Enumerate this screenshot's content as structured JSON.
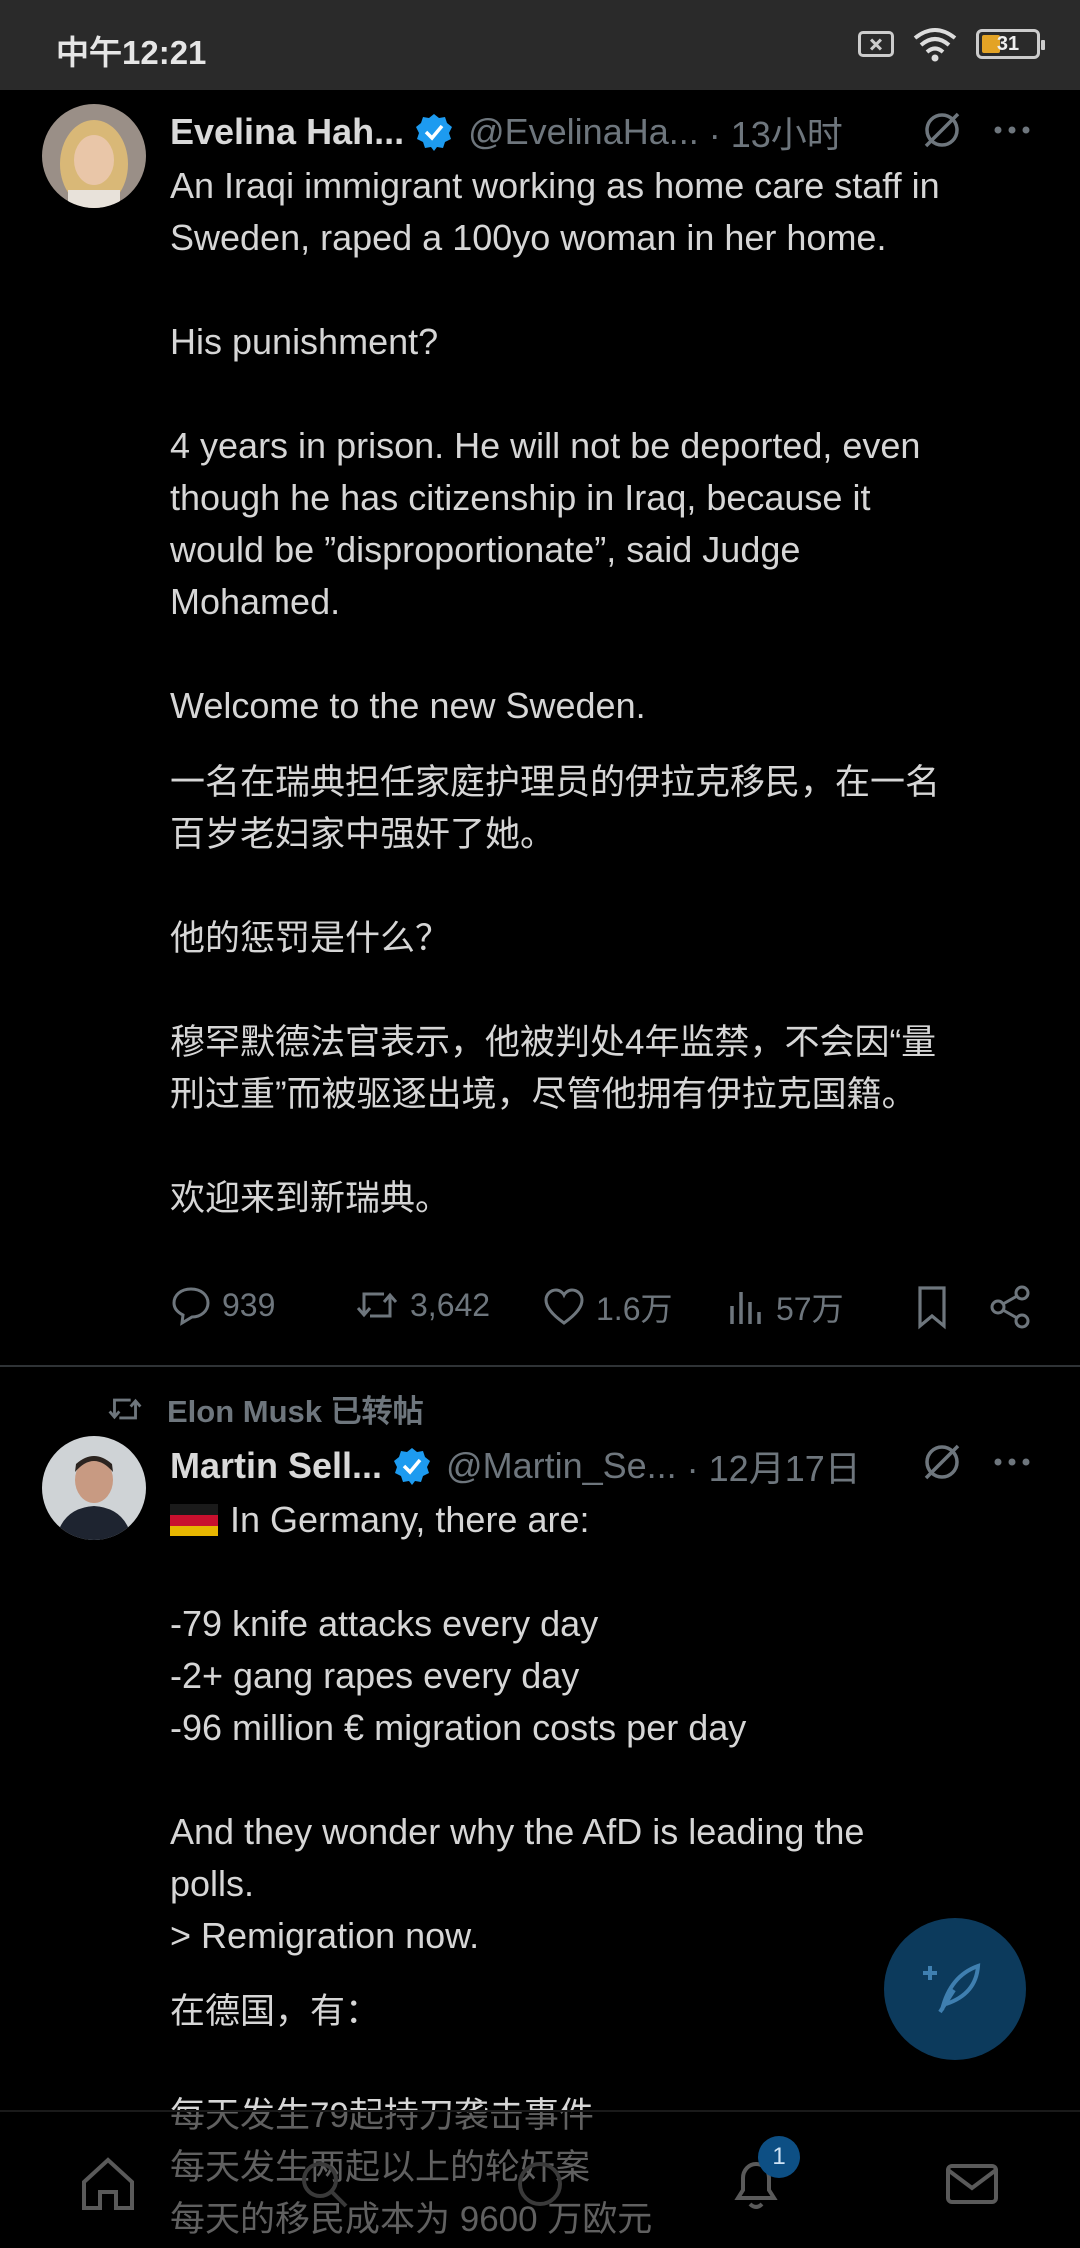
{
  "status_bar": {
    "time": "中午12:21",
    "battery": "31"
  },
  "tweet1": {
    "name": "Evelina Hah...",
    "handle": "@EvelinaHa...",
    "time": "· 13小时",
    "text_en": "An Iraqi immigrant working as home care staff in\nSweden, raped a 100yo woman in her home.\n\nHis punishment?\n\n4 years in prison. He will not be deported, even\nthough he has citizenship in Iraq, because it\nwould be ”disproportionate”, said Judge\nMohamed.\n\nWelcome to the new Sweden.",
    "text_cn": "一名在瑞典担任家庭护理员的伊拉克移民，在一名\n百岁老妇家中强奸了她。\n\n他的惩罚是什么？\n\n穆罕默德法官表示，他被判处4年监禁，不会因“量\n刑过重”而被驱逐出境，尽管他拥有伊拉克国籍。\n\n欢迎来到新瑞典。",
    "replies": "939",
    "reposts": "3,642",
    "likes": "1.6万",
    "views": "57万"
  },
  "repost_label": "Elon Musk 已转帖",
  "tweet2": {
    "name": "Martin Sell...",
    "handle": "@Martin_Se...",
    "time": "· 12月17日",
    "flag": "🇩🇪",
    "text_en_first": "In Germany, there are:",
    "text_en": "\n-79 knife attacks every day\n-2+ gang rapes every day\n-96 million € migration costs per day\n\nAnd they wonder why the AfD is leading the\npolls.\n> Remigration now.",
    "text_cn": "在德国，有：\n\n每天发生79起持刀袭击事件\n每天发生两起以上的轮奸案\n每天的移民成本为 9600 万欧元"
  },
  "nav": {
    "notification_count": "1"
  },
  "colors": {
    "accent": "#1d9bf0",
    "muted": "#6e767d",
    "background": "#000000"
  }
}
